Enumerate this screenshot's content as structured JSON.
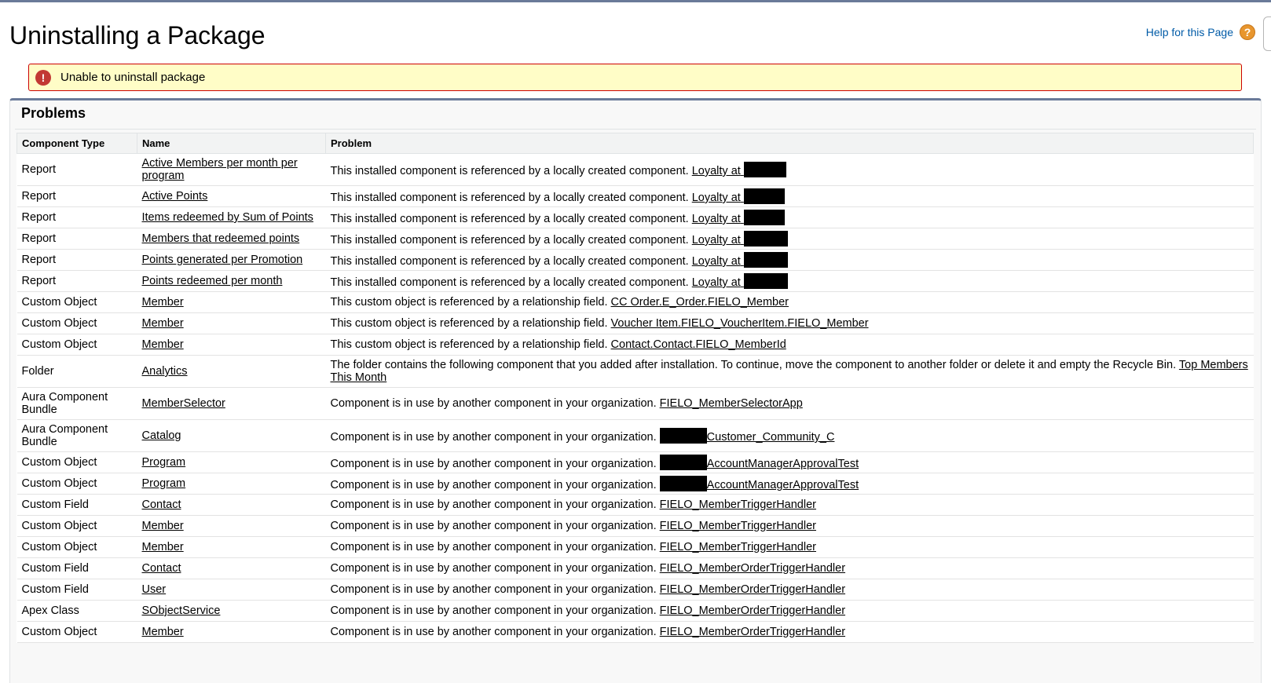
{
  "page": {
    "title": "Uninstalling a Package",
    "help_label": "Help for this Page",
    "help_icon": "question-circle-icon"
  },
  "error": {
    "icon": "error-exclamation-icon",
    "message": "Unable to uninstall package",
    "colors": {
      "border": "#cc0000",
      "background": "#fffdc7"
    }
  },
  "problems": {
    "title": "Problems",
    "columns": [
      "Component Type",
      "Name",
      "Problem"
    ],
    "rows": [
      {
        "type": "Report",
        "name": "Active Members per month per program",
        "problem": "This installed component is referenced by a locally created component.",
        "ref_pre": "Loyalty at",
        "redact": "after",
        "ref_post": "",
        "tall": true
      },
      {
        "type": "Report",
        "name": "Active Points",
        "problem": "This installed component is referenced by a locally created component.",
        "ref_pre": "Loyalty at",
        "redact": "after",
        "ref_post": ""
      },
      {
        "type": "Report",
        "name": "Items redeemed by Sum of Points",
        "problem": "This installed component is referenced by a locally created component.",
        "ref_pre": "Loyalty at",
        "redact": "after",
        "ref_post": ""
      },
      {
        "type": "Report",
        "name": "Members that redeemed points",
        "problem": "This installed component is referenced by a locally created component.",
        "ref_pre": "Loyalty at",
        "redact": "after",
        "ref_post": ""
      },
      {
        "type": "Report",
        "name": "Points generated per Promotion",
        "problem": "This installed component is referenced by a locally created component.",
        "ref_pre": "Loyalty at",
        "redact": "after",
        "ref_post": ""
      },
      {
        "type": "Report",
        "name": "Points redeemed per month",
        "problem": "This installed component is referenced by a locally created component.",
        "ref_pre": "Loyalty at",
        "redact": "after",
        "ref_post": ""
      },
      {
        "type": "Custom Object",
        "name": "Member",
        "problem": "This custom object is referenced by a relationship field.",
        "ref_pre": "CC Order.E_Order.FIELO_Member",
        "redact": "none",
        "ref_post": ""
      },
      {
        "type": "Custom Object",
        "name": "Member",
        "problem": "This custom object is referenced by a relationship field.",
        "ref_pre": "Voucher Item.FIELO_VoucherItem.FIELO_Member",
        "redact": "none",
        "ref_post": ""
      },
      {
        "type": "Custom Object",
        "name": "Member",
        "problem": "This custom object is referenced by a relationship field.",
        "ref_pre": "Contact.Contact.FIELO_MemberId",
        "redact": "none",
        "ref_post": ""
      },
      {
        "type": "Folder",
        "name": "Analytics",
        "problem": "The folder contains the following component that you added after installation. To continue, move the component to another folder or delete it and empty the Recycle Bin.",
        "ref_pre": "Top Members This Month",
        "redact": "none",
        "ref_post": "",
        "tall": true
      },
      {
        "type": "Aura Component Bundle",
        "name": "MemberSelector",
        "problem": "Component is in use by another component in your organization.",
        "ref_pre": "FIELO_MemberSelectorApp",
        "redact": "none",
        "ref_post": "",
        "tall": true
      },
      {
        "type": "Aura Component Bundle",
        "name": "Catalog",
        "problem": "Component is in use by another component in your organization.",
        "ref_pre": "",
        "redact": "before",
        "ref_post": "Customer_Community_C",
        "tall": true
      },
      {
        "type": "Custom Object",
        "name": "Program",
        "problem": "Component is in use by another component in your organization.",
        "ref_pre": "",
        "redact": "before",
        "ref_post": "AccountManagerApprovalTest"
      },
      {
        "type": "Custom Object",
        "name": "Program",
        "problem": "Component is in use by another component in your organization.",
        "ref_pre": "",
        "redact": "before",
        "ref_post": "AccountManagerApprovalTest"
      },
      {
        "type": "Custom Field",
        "name": "Contact",
        "problem": "Component is in use by another component in your organization.",
        "ref_pre": "FIELO_MemberTriggerHandler",
        "redact": "none",
        "ref_post": ""
      },
      {
        "type": "Custom Object",
        "name": "Member",
        "problem": "Component is in use by another component in your organization.",
        "ref_pre": "FIELO_MemberTriggerHandler",
        "redact": "none",
        "ref_post": ""
      },
      {
        "type": "Custom Object",
        "name": "Member",
        "problem": "Component is in use by another component in your organization.",
        "ref_pre": "FIELO_MemberTriggerHandler",
        "redact": "none",
        "ref_post": ""
      },
      {
        "type": "Custom Field",
        "name": "Contact",
        "problem": "Component is in use by another component in your organization.",
        "ref_pre": "FIELO_MemberOrderTriggerHandler",
        "redact": "none",
        "ref_post": ""
      },
      {
        "type": "Custom Field",
        "name": "User",
        "problem": "Component is in use by another component in your organization.",
        "ref_pre": "FIELO_MemberOrderTriggerHandler",
        "redact": "none",
        "ref_post": ""
      },
      {
        "type": "Apex Class",
        "name": "SObjectService",
        "problem": "Component is in use by another component in your organization.",
        "ref_pre": "FIELO_MemberOrderTriggerHandler",
        "redact": "none",
        "ref_post": ""
      },
      {
        "type": "Custom Object",
        "name": "Member",
        "problem": "Component is in use by another component in your organization.",
        "ref_pre": "FIELO_MemberOrderTriggerHandler",
        "redact": "none",
        "ref_post": ""
      }
    ]
  }
}
